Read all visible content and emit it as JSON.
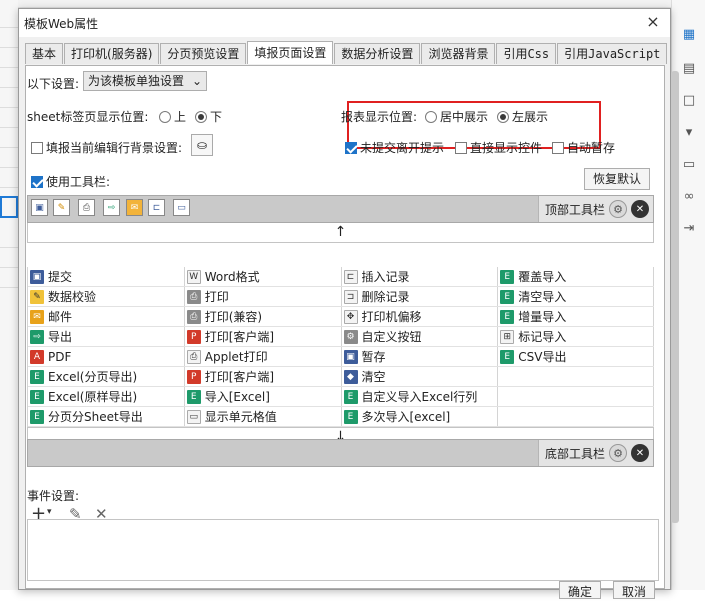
{
  "dialog": {
    "title": "模板Web属性",
    "close_icon": "×",
    "tabs": [
      "基本",
      "打印机(服务器)",
      "分页预览设置",
      "填报页面设置",
      "数据分析设置",
      "浏览器背景",
      "引用Css",
      "引用JavaScript"
    ],
    "active_tab": "填报页面设置"
  },
  "settings": {
    "scope_label": "以下设置:",
    "scope_value": "为该模板单独设置",
    "sheet_label": "sheet标签页显示位置:",
    "sheet_options": [
      "上",
      "下"
    ],
    "sheet_selected": "下",
    "report_pos_label": "报表显示位置:",
    "report_pos_options": [
      "居中展示",
      "左展示"
    ],
    "report_pos_selected": "左展示",
    "bg_label": "填报当前编辑行背景设置:",
    "unsubmitted_label": "未提交离开提示",
    "direct_show_label": "直接显示控件",
    "autosave_label": "自动暂存",
    "use_toolbar_label": "使用工具栏:",
    "restore_default": "恢复默认"
  },
  "top_toolbar": {
    "label": "顶部工具栏",
    "icons": [
      "save-icon",
      "check-icon",
      "print-icon",
      "export-icon",
      "mail-icon",
      "insert-record-icon",
      "cell-value-icon"
    ],
    "arrow": "↑"
  },
  "bottom_toolbar": {
    "label": "底部工具栏",
    "arrow": "↓"
  },
  "buttons_grid": [
    [
      {
        "label": "提交",
        "icon": "submit-icon",
        "color": "blue"
      },
      {
        "label": "Word格式",
        "icon": "word-icon",
        "color": "light"
      },
      {
        "label": "插入记录",
        "icon": "insert-record-icon",
        "color": "light"
      },
      {
        "label": "覆盖导入",
        "icon": "overwrite-import-icon",
        "color": "green"
      }
    ],
    [
      {
        "label": "数据校验",
        "icon": "data-check-icon",
        "color": "pencil"
      },
      {
        "label": "打印",
        "icon": "print-icon",
        "color": "gray"
      },
      {
        "label": "删除记录",
        "icon": "delete-record-icon",
        "color": "light"
      },
      {
        "label": "清空导入",
        "icon": "clear-import-icon",
        "color": "green"
      }
    ],
    [
      {
        "label": "邮件",
        "icon": "mail-icon",
        "color": "yellow"
      },
      {
        "label": "打印(兼容)",
        "icon": "print-compatible-icon",
        "color": "gray"
      },
      {
        "label": "打印机偏移",
        "icon": "printer-offset-icon",
        "color": "light"
      },
      {
        "label": "增量导入",
        "icon": "incremental-import-icon",
        "color": "green"
      }
    ],
    [
      {
        "label": "导出",
        "icon": "export-icon",
        "color": "green"
      },
      {
        "label": "打印[客户端]",
        "icon": "print-client-icon",
        "color": "red"
      },
      {
        "label": "自定义按钮",
        "icon": "custom-button-icon",
        "color": "gray"
      },
      {
        "label": "标记导入",
        "icon": "mark-import-icon",
        "color": "light"
      }
    ],
    [
      {
        "label": "PDF",
        "icon": "pdf-icon",
        "color": "red"
      },
      {
        "label": "Applet打印",
        "icon": "applet-print-icon",
        "color": "light"
      },
      {
        "label": "暂存",
        "icon": "temp-save-icon",
        "color": "blue"
      },
      {
        "label": "CSV导出",
        "icon": "csv-export-icon",
        "color": "green"
      }
    ],
    [
      {
        "label": "Excel(分页导出)",
        "icon": "excel-page-export-icon",
        "color": "green"
      },
      {
        "label": "打印[客户端]",
        "icon": "print-client-icon",
        "color": "red"
      },
      {
        "label": "清空",
        "icon": "clear-icon",
        "color": "blue"
      },
      {
        "label": "",
        "icon": "",
        "color": ""
      }
    ],
    [
      {
        "label": "Excel(原样导出)",
        "icon": "excel-original-export-icon",
        "color": "green"
      },
      {
        "label": "导入[Excel]",
        "icon": "import-excel-icon",
        "color": "green"
      },
      {
        "label": "自定义导入Excel行列",
        "icon": "custom-import-excel-icon",
        "color": "green"
      },
      {
        "label": "",
        "icon": "",
        "color": ""
      }
    ],
    [
      {
        "label": "分页分Sheet导出",
        "icon": "sheet-export-icon",
        "color": "green"
      },
      {
        "label": "显示单元格值",
        "icon": "show-cell-value-icon",
        "color": "light"
      },
      {
        "label": "多次导入[excel]",
        "icon": "multi-import-excel-icon",
        "color": "green"
      },
      {
        "label": "",
        "icon": "",
        "color": ""
      }
    ]
  ],
  "events": {
    "label": "事件设置:",
    "add_icon": "+",
    "edit_icon": "✎",
    "delete_icon": "✕"
  },
  "footer": {
    "ok": "确定",
    "cancel": "取消"
  },
  "colors": {
    "highlight": "#e02020",
    "accent": "#1e73c8"
  }
}
